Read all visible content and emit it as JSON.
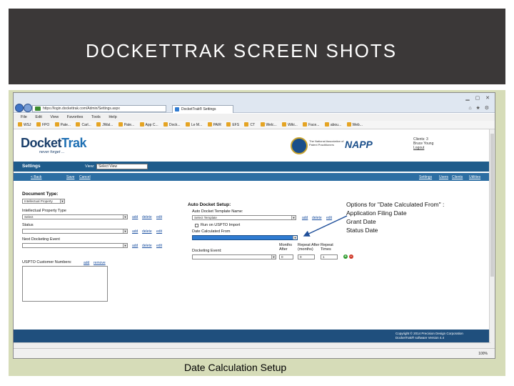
{
  "slide": {
    "title": "DOCKETTRAK SCREEN SHOTS",
    "caption": "Date Calculation Setup",
    "callout_lines": [
      "Options for \"Date Calculated From\" :",
      "Application Filing Date",
      "Grant Date",
      "Status Date"
    ]
  },
  "browser": {
    "url": "https://login.dockettrak.com/Admin/Settings.aspx",
    "tab_title": "DocketTrak® Settings",
    "menu": [
      "File",
      "Edit",
      "View",
      "Favorites",
      "Tools",
      "Help"
    ],
    "favorites": [
      "WSJ",
      "FPO",
      "Pate...",
      "Carl...",
      "JWal...",
      "Pate...",
      "App C...",
      "Dock...",
      "Le M...",
      "PAIR",
      "EFS",
      "CT",
      "Welc...",
      "Wiki...",
      "Face...",
      "abou...",
      "Web..."
    ],
    "zoom": "100%"
  },
  "app": {
    "logo_docket": "Docket",
    "logo_trak": "Trak",
    "tagline": "never forget ...",
    "napp_org": "The National Association of Patent Practitioners",
    "napp": "NAPP",
    "user_lines": [
      "Clients: 3",
      "Bruce Young",
      "Logout"
    ],
    "page_title": "Settings",
    "view_label": "View:",
    "view_value": "Select View",
    "back_link": "< Back",
    "save_link": "Save",
    "cancel_link": "Cancel",
    "right_links": [
      "Settings",
      "Users",
      "Clients",
      "Utilities"
    ],
    "copyright": [
      "Copyright © 2014 Precision Design Corporation",
      "DocketTrak® software Version 4.4"
    ]
  },
  "form": {
    "document_type_label": "Document Type:",
    "document_type_value": "Intellectual Property",
    "ip_type_label": "Intellectual Property Type",
    "ip_type_value": "Select",
    "status_label": "Status",
    "next_event_label": "Next Docketing Event",
    "uspto_label": "USPTO Customer Numbers:",
    "add": "add",
    "delete": "delete",
    "edit": "edit",
    "remove": "remove",
    "auto_setup_label": "Auto Docket Setup:",
    "template_label": "Auto Docket Template Name:",
    "template_value": "Select Template",
    "run_on_import": "Run on USPTO Import",
    "date_calc_label": "Date Calculated From",
    "docketing_event_label": "Docketing Event:",
    "months_after_label": [
      "Months",
      "After"
    ],
    "repeat_after_label": [
      "Repeat After",
      "(months)"
    ],
    "repeat_times_label": [
      "Repeat",
      "Times"
    ],
    "months_value": "0",
    "repeat_after_value": "0",
    "repeat_times_value": "1",
    "add_symbol": "+",
    "remove_symbol": "−"
  },
  "colors": {
    "header_bg": "#3b3838",
    "frame_bg": "#d6dcb8",
    "app_dark_blue": "#1f5c8b",
    "app_blue": "#2c6ea3"
  }
}
